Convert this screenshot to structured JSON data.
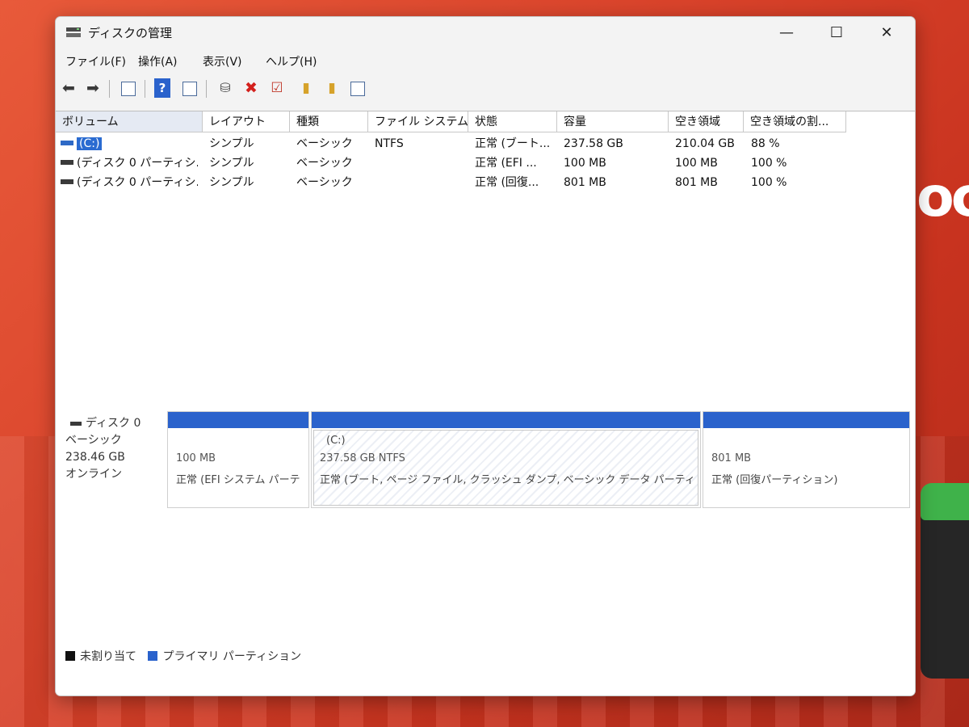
{
  "window": {
    "title": "ディスクの管理"
  },
  "menu": {
    "file": "ファイル(F)",
    "action": "操作(A)",
    "view": "表示(V)",
    "help": "ヘルプ(H)"
  },
  "columns": [
    "ボリューム",
    "レイアウト",
    "種類",
    "ファイル システム",
    "状態",
    "容量",
    "空き領域",
    "空き領域の割..."
  ],
  "volumes": [
    {
      "name": "(C:)",
      "layout": "シンプル",
      "type": "ベーシック",
      "fs": "NTFS",
      "status": "正常 (ブート...",
      "capacity": "237.58 GB",
      "free": "210.04 GB",
      "free_pct": "88 %"
    },
    {
      "name": "(ディスク 0 パーティシ...",
      "layout": "シンプル",
      "type": "ベーシック",
      "fs": "",
      "status": "正常 (EFI ...",
      "capacity": "100 MB",
      "free": "100 MB",
      "free_pct": "100 %"
    },
    {
      "name": "(ディスク 0 パーティシ...",
      "layout": "シンプル",
      "type": "ベーシック",
      "fs": "",
      "status": "正常 (回復...",
      "capacity": "801 MB",
      "free": "801 MB",
      "free_pct": "100 %"
    }
  ],
  "disk": {
    "name": "ディスク 0",
    "type": "ベーシック",
    "size": "238.46 GB",
    "state": "オンライン"
  },
  "partitions": [
    {
      "line1": "100 MB",
      "line2": "正常 (EFI システム パーテ"
    },
    {
      "label": "(C:)",
      "line1": "237.58 GB NTFS",
      "line2": "正常 (ブート, ページ ファイル, クラッシュ ダンプ, ベーシック データ パーティ"
    },
    {
      "line1": "801 MB",
      "line2": "正常 (回復パーティション)"
    }
  ],
  "legend": {
    "unallocated": "未割り当て",
    "primary": "プライマリ パーティション"
  },
  "background": {
    "logo": "oc"
  },
  "colors": {
    "partition_bar": "#2a62cc",
    "selection": "#2a6bd1",
    "unallocated": "#111111",
    "primary": "#2a62cc"
  }
}
